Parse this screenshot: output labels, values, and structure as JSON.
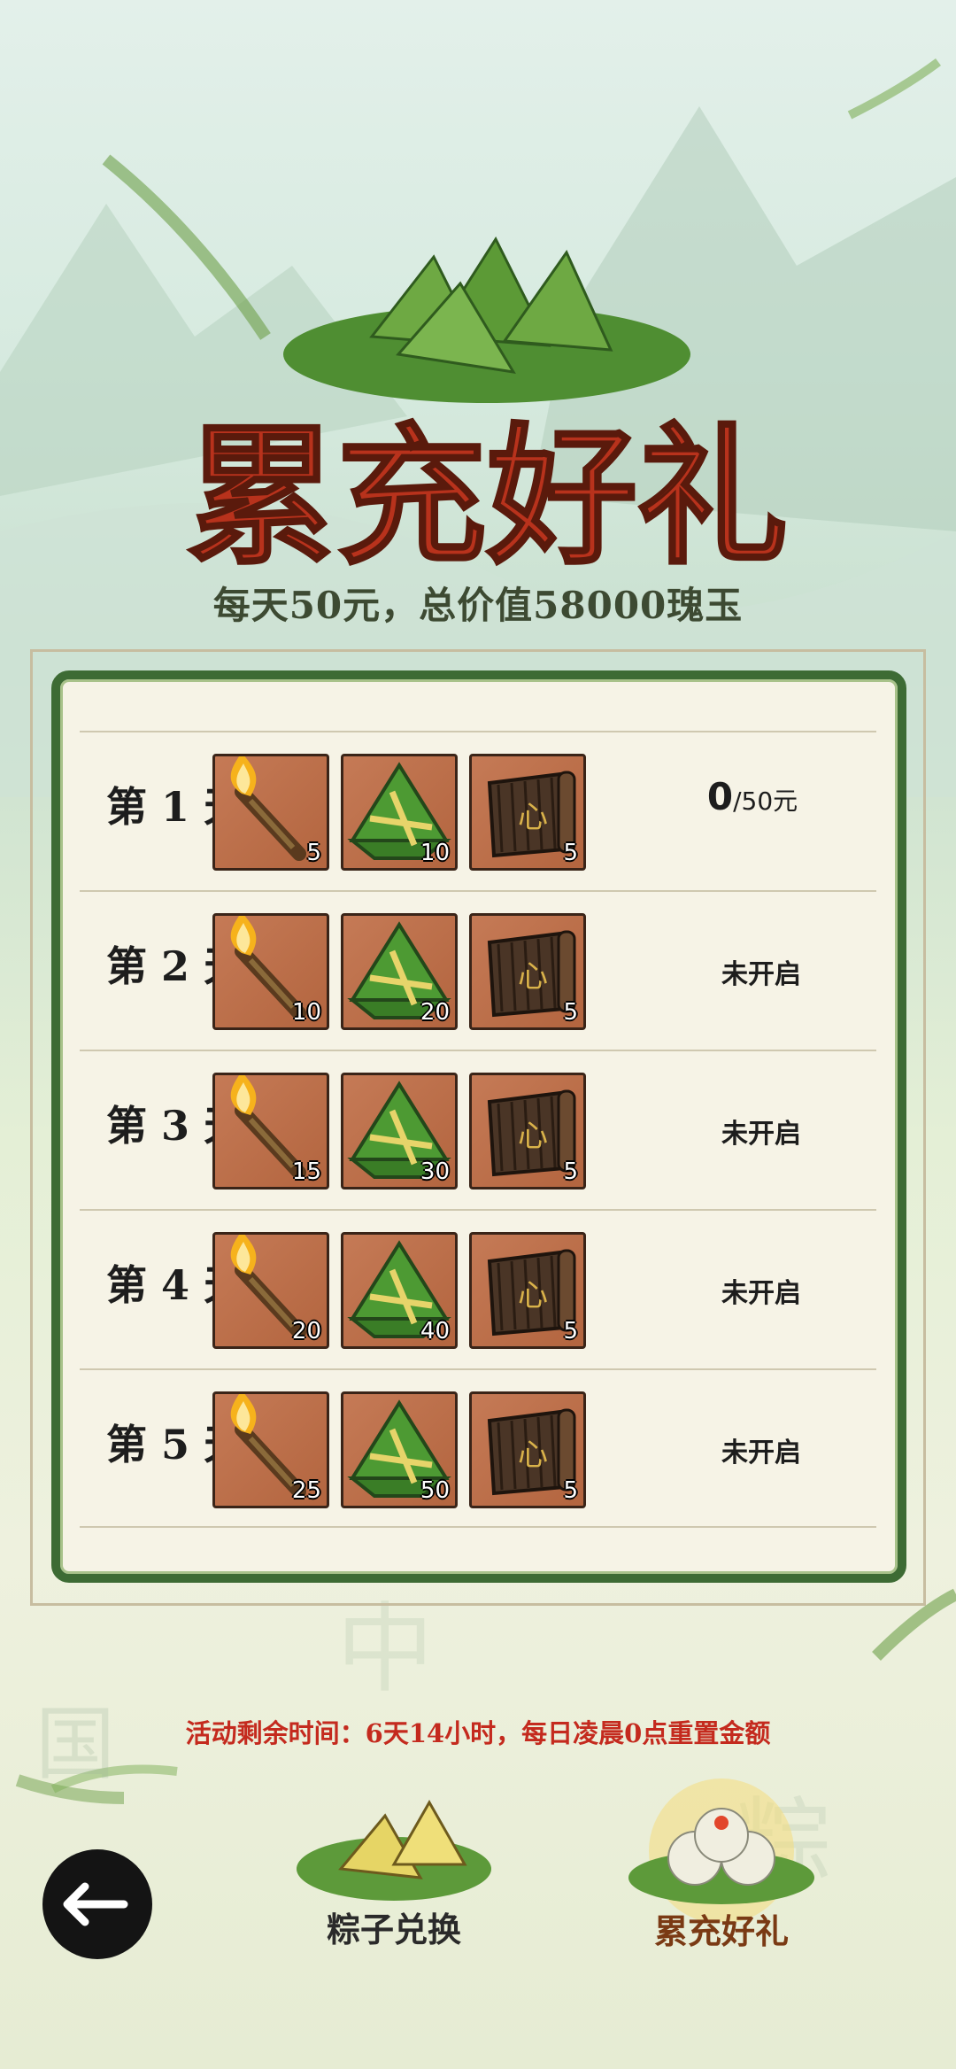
{
  "event": {
    "title": "累充好礼",
    "subtitle": "每天50元，总价值58000瑰玉"
  },
  "days": [
    {
      "label": "第 1 天",
      "items": [
        {
          "icon": "torch-icon",
          "qty": "5"
        },
        {
          "icon": "zongzi-icon",
          "qty": "10"
        },
        {
          "icon": "scroll-icon",
          "qty": "5"
        }
      ],
      "progress_current": "0",
      "progress_total": "/50元",
      "status": ""
    },
    {
      "label": "第 2 天",
      "items": [
        {
          "icon": "torch-icon",
          "qty": "10"
        },
        {
          "icon": "zongzi-icon",
          "qty": "20"
        },
        {
          "icon": "scroll-icon",
          "qty": "5"
        }
      ],
      "status": "未开启"
    },
    {
      "label": "第 3 天",
      "items": [
        {
          "icon": "torch-icon",
          "qty": "15"
        },
        {
          "icon": "zongzi-icon",
          "qty": "30"
        },
        {
          "icon": "scroll-icon",
          "qty": "5"
        }
      ],
      "status": "未开启"
    },
    {
      "label": "第 4 天",
      "items": [
        {
          "icon": "torch-icon",
          "qty": "20"
        },
        {
          "icon": "zongzi-icon",
          "qty": "40"
        },
        {
          "icon": "scroll-icon",
          "qty": "5"
        }
      ],
      "status": "未开启"
    },
    {
      "label": "第 5 天",
      "items": [
        {
          "icon": "torch-icon",
          "qty": "25"
        },
        {
          "icon": "zongzi-icon",
          "qty": "50"
        },
        {
          "icon": "scroll-icon",
          "qty": "5"
        }
      ],
      "status": "未开启"
    }
  ],
  "timer_text": "活动剩余时间：6天14小时，每日凌晨0点重置金额",
  "nav": {
    "back_icon": "back-arrow-icon",
    "tabs": [
      {
        "label": "粽子兑换",
        "icon": "zongzi-leaf-icon",
        "active": false
      },
      {
        "label": "累充好礼",
        "icon": "tangyuan-icon",
        "active": true
      }
    ]
  },
  "colors": {
    "title_red": "#b8321c",
    "panel_border": "#3d6b34",
    "timer_red": "#c42a1e",
    "item_bg": "#c06f4b"
  }
}
